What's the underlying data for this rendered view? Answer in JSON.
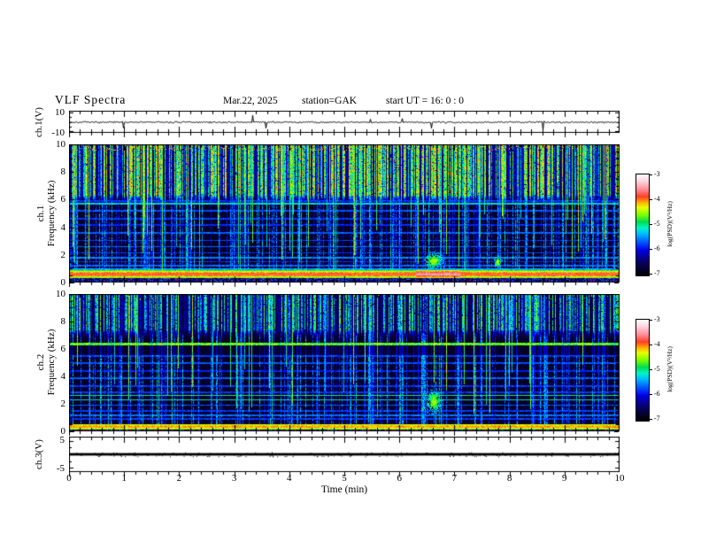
{
  "header": {
    "title": "VLF  Spectra",
    "date": "Mar.22, 2025",
    "station": "station=GAK",
    "start": "start UT =  16: 0  : 0"
  },
  "panels": {
    "ch1_wave": {
      "label": "ch.1(V)",
      "ytick_labels": [
        "10",
        "-10"
      ]
    },
    "spec1": {
      "channel": "ch.1",
      "axis_label": "Frequency  (kHz)",
      "ytick_labels": [
        "10",
        "8",
        "6",
        "4",
        "2",
        "0"
      ]
    },
    "spec2": {
      "channel": "ch.2",
      "axis_label": "Frequency  (kHz)",
      "ytick_labels": [
        "10",
        "8",
        "6",
        "4",
        "2",
        "0"
      ]
    },
    "ch3": {
      "label": "ch.3(V)",
      "ytick_labels": [
        "5",
        "-5"
      ]
    }
  },
  "xaxis": {
    "label": "Time  (min)",
    "tick_labels": [
      "0",
      "1",
      "2",
      "3",
      "4",
      "5",
      "6",
      "7",
      "8",
      "9",
      "10"
    ],
    "range": [
      0,
      10
    ],
    "minor_step": 0.2
  },
  "colorbar": {
    "label": "log(PSD)(V²/Hz)",
    "tick_labels": [
      "-3",
      "-4",
      "-5",
      "-6",
      "-7"
    ],
    "z_range": [
      -7,
      -3
    ]
  },
  "colormap": [
    [
      0,
      "#000000"
    ],
    [
      0.13,
      "#0a0060"
    ],
    [
      0.25,
      "#0000e6"
    ],
    [
      0.33,
      "#0057ff"
    ],
    [
      0.41,
      "#00baff"
    ],
    [
      0.47,
      "#00f5c8"
    ],
    [
      0.53,
      "#00dc50"
    ],
    [
      0.6,
      "#7dff00"
    ],
    [
      0.67,
      "#e6ff00"
    ],
    [
      0.72,
      "#ffb400"
    ],
    [
      0.78,
      "#ff4028"
    ],
    [
      0.85,
      "#ff8c96"
    ],
    [
      0.93,
      "#ffd2dc"
    ],
    [
      1,
      "#ffffff"
    ]
  ],
  "chart_data": [
    {
      "type": "line",
      "name": "ch1_waveform",
      "ylabel": "ch.1(V)",
      "x_range": [
        0,
        10
      ],
      "y_range": [
        -12,
        12
      ],
      "yticks_major": [
        10,
        -10
      ],
      "yticks_minor": [
        5,
        0,
        -5
      ],
      "signal": {
        "seed": 7,
        "mean": -0.5,
        "noise_amp": 1.3,
        "spike_prob": 0.012,
        "spike_min": 3,
        "spike_max": 8.5,
        "spike_neg_frac": 0.55
      }
    },
    {
      "type": "heatmap",
      "name": "ch1_spectrogram",
      "ylabel": "ch.1 Frequency (kHz)",
      "x_range": [
        0,
        10
      ],
      "y_range": [
        0,
        10
      ],
      "z_range": [
        -7,
        -3
      ],
      "seed": 101,
      "f_max": 10,
      "top_band": {
        "f_lo": 6.3,
        "density": 0.55,
        "streak_lo": 0.42,
        "streak_hi": 0.72,
        "base_lo": 0.1,
        "base_hi": 0.26,
        "cap": 0.72,
        "yellow_frac": 0.16,
        "orange_speck_frac": 0.1
      },
      "transition_f_lo": 5.35,
      "mid_streak_density": 0.32,
      "tall_spike_density": 0.1,
      "h_lines": [
        {
          "f": 5.9,
          "v": 0.3
        },
        {
          "f": 5.7,
          "v": 0.44,
          "w": 0.08
        },
        {
          "f": 5.2,
          "v": 0.32
        },
        {
          "f": 4.6,
          "v": 0.3
        },
        {
          "f": 4.15,
          "v": 0.28
        },
        {
          "f": 3.6,
          "v": 0.33
        },
        {
          "f": 3.05,
          "v": 0.3
        },
        {
          "f": 2.6,
          "v": 0.34
        },
        {
          "f": 2.15,
          "v": 0.3
        },
        {
          "f": 1.8,
          "v": 0.36
        },
        {
          "f": 1.5,
          "v": 0.3
        },
        {
          "f": 1.2,
          "v": 0.34
        },
        {
          "f": 0.95,
          "v": 0.4
        }
      ],
      "bottom_band": {
        "f_lo": 0.32,
        "f_hi": 0.88,
        "v_lo": 0.5,
        "v_hi": 0.74,
        "enh_t0": 6.3,
        "enh_t1": 7.1
      },
      "speckle_magenta": 0.1,
      "blobs": [
        {
          "t": 6.62,
          "f": 1.6,
          "w": 9,
          "h": 8
        },
        {
          "t": 7.78,
          "f": 1.5,
          "w": 4,
          "h": 6
        }
      ]
    },
    {
      "type": "heatmap",
      "name": "ch2_spectrogram",
      "ylabel": "ch.2 Frequency (kHz)",
      "x_range": [
        0,
        10
      ],
      "y_range": [
        0,
        10
      ],
      "z_range": [
        -7,
        -3
      ],
      "seed": 202,
      "f_max": 10,
      "top_band": {
        "f_lo": 7.35,
        "density": 0.42,
        "streak_lo": 0.34,
        "streak_hi": 0.58,
        "base_lo": 0.08,
        "base_hi": 0.2,
        "cap": 0.6,
        "yellow_frac": 0.08,
        "orange_speck_frac": 0.02
      },
      "transition_f_lo": 6.45,
      "dark_zone": [
        5.55,
        6.25
      ],
      "mid_streak_density": 0.25,
      "tall_spike_density": 0.07,
      "h_lines": [
        {
          "f": 6.35,
          "v": 0.58,
          "w": 0.09
        },
        {
          "f": 5.5,
          "v": 0.3
        },
        {
          "f": 4.95,
          "v": 0.32
        },
        {
          "f": 4.4,
          "v": 0.28
        },
        {
          "f": 3.85,
          "v": 0.33
        },
        {
          "f": 3.3,
          "v": 0.3
        },
        {
          "f": 2.85,
          "v": 0.3
        },
        {
          "f": 2.6,
          "v": 0.5,
          "w": 0.05
        },
        {
          "f": 2.3,
          "v": 0.48,
          "w": 0.05
        },
        {
          "f": 1.9,
          "v": 0.33
        },
        {
          "f": 1.5,
          "v": 0.3
        },
        {
          "f": 1.15,
          "v": 0.35
        },
        {
          "f": 0.9,
          "v": 0.3
        }
      ],
      "bottom_band": {
        "f_lo": 0.16,
        "f_hi": 0.52,
        "v_lo": 0.56,
        "v_hi": 0.68
      },
      "speckle_magenta": 0.22,
      "blobs": [
        {
          "t": 6.62,
          "f": 2.2,
          "w": 7,
          "h": 12
        }
      ]
    },
    {
      "type": "line",
      "name": "ch3_waveform",
      "ylabel": "ch.3(V)",
      "x_range": [
        0,
        10
      ],
      "y_range": [
        -6.5,
        6.5
      ],
      "yticks_major": [
        5,
        -5
      ],
      "yticks_minor": [
        2.5,
        0,
        -2.5
      ],
      "signal": {
        "seed": 33,
        "constant": 0,
        "thickness_v": 0.9
      }
    }
  ]
}
